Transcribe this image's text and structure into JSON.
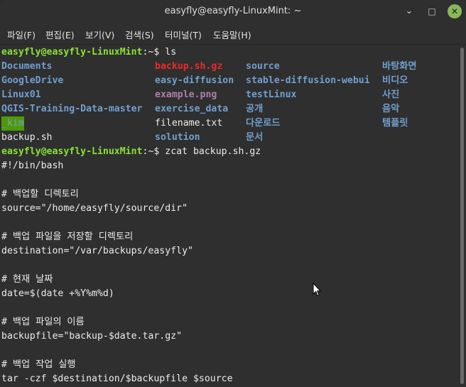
{
  "window": {
    "title": "easyfly@easyfly-LinuxMint: ~",
    "minimize_glyph": "⌄",
    "maximize_glyph": "□",
    "close_glyph": "✕"
  },
  "menubar": [
    "파일(F)",
    "편집(E)",
    "보기(V)",
    "검색(S)",
    "터미널(T)",
    "도움말(H)"
  ],
  "prompt": {
    "user": "easyfly@easyfly-LinuxMint",
    "path_suffix": ":~$ "
  },
  "commands": [
    "ls",
    "zcat backup.sh.gz"
  ],
  "ls_output": {
    "columns": [
      [
        "Documents",
        "GoogleDrive",
        "Linux01",
        "QGIS-Training-Data-master",
        "_kim",
        "backup.sh"
      ],
      [
        "backup.sh.gz",
        "easy-diffusion",
        "example.png",
        "exercise_data",
        "filename.txt",
        "solution"
      ],
      [
        "source",
        "stable-diffusion-webui",
        "testLinux",
        "공개",
        "다운로드",
        "문서"
      ],
      [
        "바탕화면",
        "비디오",
        "사진",
        "음악",
        "템플릿"
      ]
    ]
  },
  "script_lines": [
    "#!/bin/bash",
    "",
    "# 백업할 디렉토리",
    "source=\"/home/easyfly/source/dir\"",
    "",
    "# 백업 파일을 저장할 디렉토리",
    "destination=\"/var/backups/easyfly\"",
    "",
    "# 현재 날짜",
    "date=$(date +%Y%m%d)",
    "",
    "# 백업 파일의 이름",
    "backupfile=\"backup-$date.tar.gz\"",
    "",
    "# 백업 작업 실행",
    "tar -czf $destination/$backupfile $source"
  ],
  "colors": {
    "prompt_user": "#8ae234",
    "directory": "#729fcf",
    "archive": "#ef2929",
    "image_file": "#ad7fa8",
    "highlight_bg": "#4e9a06",
    "text": "#ececec",
    "background": "#2f2f2f",
    "close_button": "#8ab859"
  }
}
